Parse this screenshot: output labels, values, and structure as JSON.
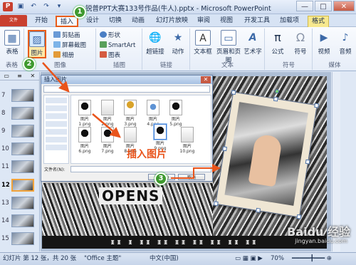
{
  "window": {
    "title": "锐普PPT大赛133号作品(牛人).pptx - Microsoft PowerPoint",
    "app_icon": "P",
    "buttons": [
      "—",
      "□",
      "✕"
    ]
  },
  "tabs": [
    "文件",
    "开始",
    "插入",
    "设计",
    "切换",
    "动画",
    "幻灯片放映",
    "审阅",
    "视图",
    "开发工具",
    "加载项",
    "格式"
  ],
  "active_tab": "插入",
  "ribbon": {
    "groups": [
      {
        "label": "表格",
        "buttons": [
          "表格"
        ]
      },
      {
        "label": "图像",
        "buttons": [
          "图片",
          "剪贴画",
          "屏幕截图",
          "相册"
        ]
      },
      {
        "label": "插图",
        "buttons": [
          "形状",
          "SmartArt",
          "图表"
        ]
      },
      {
        "label": "链接",
        "buttons": [
          "超链接",
          "动作"
        ]
      },
      {
        "label": "文本",
        "buttons": [
          "文本框",
          "页眉和页脚",
          "艺术字"
        ]
      },
      {
        "label": "符号",
        "buttons": [
          "公式",
          "符号"
        ]
      },
      {
        "label": "媒体",
        "buttons": [
          "视频",
          "音频"
        ]
      }
    ]
  },
  "slide_panel": {
    "numbers": [
      "7",
      "8",
      "9",
      "10",
      "11",
      "12",
      "13",
      "14",
      "15"
    ],
    "selected": "12"
  },
  "dialog": {
    "title": "插入图片",
    "files": [
      "图片1.png",
      "图片2.png",
      "图片3.png",
      "图片4.png",
      "图片5.png",
      "图片6.png",
      "图片7.png",
      "图片8.png",
      "图片9.png",
      "图片10.png"
    ],
    "filename_label": "文件名(N):",
    "buttons": [
      "插入(S)",
      "取消"
    ]
  },
  "slide": {
    "opens_text": "OPENS",
    "bottom_text": "ᵻᵻ ᵻ ᵻᵻ ᵻᵻ ᵻᵻ ᵻᵻ ᵻᵻ ᵻᵻ ᵻᵻ"
  },
  "annotations": {
    "insert_picture": "插入图片",
    "badges": [
      "1",
      "2",
      "3"
    ]
  },
  "status": {
    "slide_info": "幻灯片 第 12 张，共 20 张",
    "theme": "\"Office 主题\"",
    "language": "中文(中国)",
    "zoom": "70%"
  },
  "watermark": {
    "brand": "Baidu 经验",
    "url": "jingyan.baidu.com"
  },
  "colors": {
    "accent": "#e9541b",
    "file_tab": "#c9402f",
    "badge": "#3f9a2f"
  }
}
